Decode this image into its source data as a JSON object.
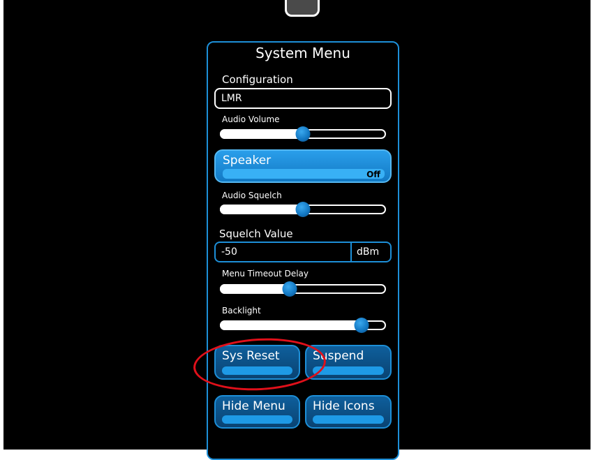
{
  "panel": {
    "title": "System Menu"
  },
  "configuration": {
    "label": "Configuration",
    "value": "LMR"
  },
  "audio_volume": {
    "label": "Audio Volume",
    "level": 0.5
  },
  "speaker": {
    "label": "Speaker",
    "state": "Off"
  },
  "audio_squelch": {
    "label": "Audio Squelch",
    "level": 0.5
  },
  "squelch_value": {
    "label": "Squelch Value",
    "value": "-50",
    "unit": "dBm"
  },
  "menu_timeout": {
    "label": "Menu Timeout Delay",
    "level": 0.42
  },
  "backlight": {
    "label": "Backlight",
    "level": 0.86
  },
  "buttons": {
    "sys_reset": "Sys Reset",
    "suspend": "Suspend",
    "hide_menu": "Hide Menu",
    "hide_icons": "Hide Icons"
  },
  "colors": {
    "accent": "#1d8fd8",
    "annotation": "#e0101a"
  }
}
